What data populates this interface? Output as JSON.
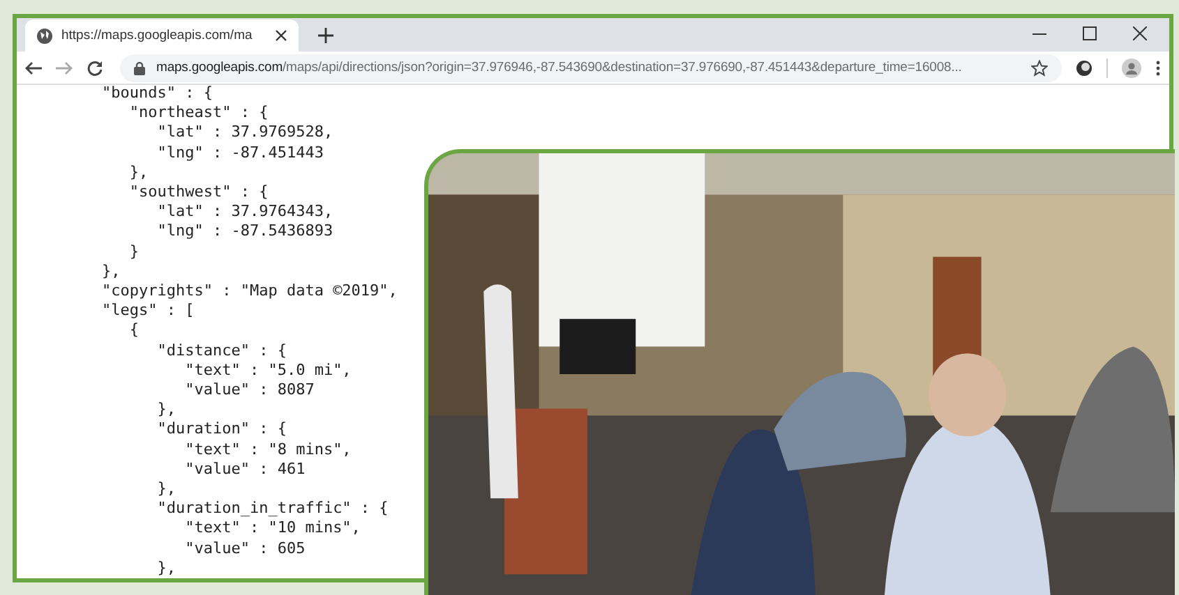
{
  "tab": {
    "title": "https://maps.googleapis.com/ma",
    "selected": true
  },
  "address_bar": {
    "host": "maps.googleapis.com",
    "path": "/maps/api/directions/json?origin=37.976946,-87.543690&destination=37.976690,-87.451443&departure_time=16008..."
  },
  "code_lines": [
    "\"bounds\" : {",
    "   \"northeast\" : {",
    "      \"lat\" : 37.9769528,",
    "      \"lng\" : -87.451443",
    "   },",
    "   \"southwest\" : {",
    "      \"lat\" : 37.9764343,",
    "      \"lng\" : -87.5436893",
    "   }",
    "},",
    "\"copyrights\" : \"Map data ©2019\",",
    "\"legs\" : [",
    "   {",
    "      \"distance\" : {",
    "         \"text\" : \"5.0 mi\",",
    "         \"value\" : 8087",
    "      },",
    "      \"duration\" : {",
    "         \"text\" : \"8 mins\",",
    "         \"value\" : 461",
    "      },",
    "      \"duration_in_traffic\" : {",
    "         \"text\" : \"10 mins\",",
    "         \"value\" : 605",
    "      },"
  ]
}
